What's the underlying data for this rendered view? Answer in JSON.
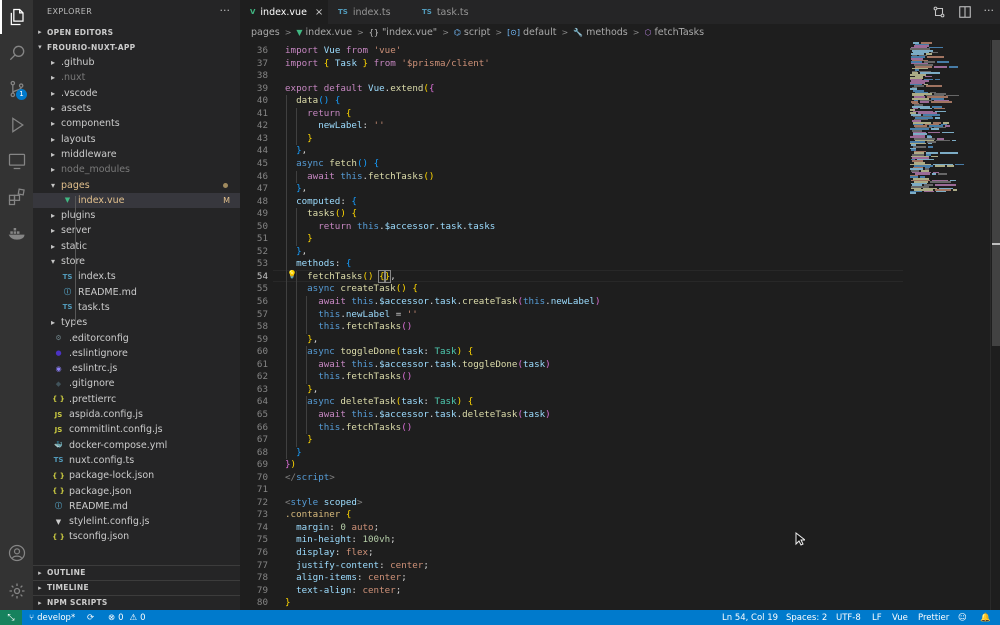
{
  "sidebar": {
    "title": "EXPLORER",
    "open_editors": "OPEN EDITORS",
    "root": "FROURIO-NUXT-APP",
    "outline": "OUTLINE",
    "timeline": "TIMELINE",
    "npm_scripts": "NPM SCRIPTS",
    "tree": [
      {
        "label": ".github",
        "type": "folder"
      },
      {
        "label": ".nuxt",
        "type": "folder",
        "dim": true
      },
      {
        "label": ".vscode",
        "type": "folder"
      },
      {
        "label": "assets",
        "type": "folder"
      },
      {
        "label": "components",
        "type": "folder"
      },
      {
        "label": "layouts",
        "type": "folder"
      },
      {
        "label": "middleware",
        "type": "folder"
      },
      {
        "label": "node_modules",
        "type": "folder",
        "dim": true
      },
      {
        "label": "pages",
        "type": "folder-open",
        "modified": true
      },
      {
        "label": "index.vue",
        "type": "vue",
        "selected": true,
        "modified": true,
        "decoration": "M"
      },
      {
        "label": "plugins",
        "type": "folder"
      },
      {
        "label": "server",
        "type": "folder"
      },
      {
        "label": "static",
        "type": "folder"
      },
      {
        "label": "store",
        "type": "folder-open"
      },
      {
        "label": "index.ts",
        "type": "ts"
      },
      {
        "label": "README.md",
        "type": "md"
      },
      {
        "label": "task.ts",
        "type": "ts"
      },
      {
        "label": "types",
        "type": "folder"
      },
      {
        "label": ".editorconfig",
        "type": "gear"
      },
      {
        "label": ".eslintignore",
        "type": "eslint"
      },
      {
        "label": ".eslintrc.js",
        "type": "eslintjs"
      },
      {
        "label": ".gitignore",
        "type": "git"
      },
      {
        "label": ".prettierrc",
        "type": "json"
      },
      {
        "label": "aspida.config.js",
        "type": "js"
      },
      {
        "label": "commitlint.config.js",
        "type": "js"
      },
      {
        "label": "docker-compose.yml",
        "type": "docker"
      },
      {
        "label": "nuxt.config.ts",
        "type": "ts"
      },
      {
        "label": "package-lock.json",
        "type": "json"
      },
      {
        "label": "package.json",
        "type": "json"
      },
      {
        "label": "README.md",
        "type": "info"
      },
      {
        "label": "stylelint.config.js",
        "type": "stylelint"
      },
      {
        "label": "tsconfig.json",
        "type": "json"
      }
    ]
  },
  "tabs": [
    {
      "label": "index.vue",
      "icon": "V",
      "active": true
    },
    {
      "label": "index.ts",
      "icon": "TS",
      "active": false
    },
    {
      "label": "task.ts",
      "icon": "TS",
      "active": false
    }
  ],
  "breadcrumb": [
    "pages",
    "index.vue",
    "\"index.vue\"",
    "script",
    "default",
    "methods",
    "fetchTasks"
  ],
  "editor": {
    "current_line": 54,
    "lines": [
      {
        "n": 36,
        "html": "<span class='c'>import</span> <span class='v'>Vue</span> <span class='c'>from</span> <span class='s'>'vue'</span>"
      },
      {
        "n": 37,
        "html": "<span class='c'>import</span> <span class='y'>{</span> <span class='v'>Task</span> <span class='y'>}</span> <span class='c'>from</span> <span class='s'>'$prisma/client'</span>"
      },
      {
        "n": 38,
        "html": ""
      },
      {
        "n": 39,
        "html": "<span class='c'>export</span> <span class='c'>default</span> <span class='v'>Vue</span>.<span class='f'>extend</span><span class='y'>(</span><span class='pk'>{</span>"
      },
      {
        "n": 40,
        "html": "  <span class='f'>data</span><span class='bl'>()</span> <span class='bl'>{</span>"
      },
      {
        "n": 41,
        "html": "    <span class='c'>return</span> <span class='y'>{</span>"
      },
      {
        "n": 42,
        "html": "      <span class='v'>newLabel</span>: <span class='s'>''</span>"
      },
      {
        "n": 43,
        "html": "    <span class='y'>}</span>"
      },
      {
        "n": 44,
        "html": "  <span class='bl'>}</span>,"
      },
      {
        "n": 45,
        "html": "  <span class='k'>async</span> <span class='f'>fetch</span><span class='bl'>()</span> <span class='bl'>{</span>"
      },
      {
        "n": 46,
        "html": "    <span class='c'>await</span> <span class='k'>this</span>.<span class='f'>fetchTasks</span><span class='y'>()</span>"
      },
      {
        "n": 47,
        "html": "  <span class='bl'>}</span>,"
      },
      {
        "n": 48,
        "html": "  <span class='v'>computed</span>: <span class='bl'>{</span>"
      },
      {
        "n": 49,
        "html": "    <span class='f'>tasks</span><span class='y'>()</span> <span class='y'>{</span>"
      },
      {
        "n": 50,
        "html": "      <span class='c'>return</span> <span class='k'>this</span>.<span class='v'>$accessor</span>.<span class='v'>task</span>.<span class='v'>tasks</span>"
      },
      {
        "n": 51,
        "html": "    <span class='y'>}</span>"
      },
      {
        "n": 52,
        "html": "  <span class='bl'>}</span>,"
      },
      {
        "n": 53,
        "html": "  <span class='v'>methods</span>: <span class='bl'>{</span>"
      },
      {
        "n": 54,
        "html": "    <span class='f'>fetchTasks</span><span class='y'>()</span> <span class='y' style='outline:1px solid #888'>{</span><span class='y' style='outline:1px solid #888'>}</span>,"
      },
      {
        "n": 55,
        "html": "    <span class='k'>async</span> <span class='f'>createTask</span><span class='y'>()</span> <span class='y'>{</span>"
      },
      {
        "n": 56,
        "html": "      <span class='c'>await</span> <span class='k'>this</span>.<span class='v'>$accessor</span>.<span class='v'>task</span>.<span class='f'>createTask</span><span class='pk'>(</span><span class='k'>this</span>.<span class='v'>newLabel</span><span class='pk'>)</span>"
      },
      {
        "n": 57,
        "html": "      <span class='k'>this</span>.<span class='v'>newLabel</span> = <span class='s'>''</span>"
      },
      {
        "n": 58,
        "html": "      <span class='k'>this</span>.<span class='f'>fetchTasks</span><span class='pk'>()</span>"
      },
      {
        "n": 59,
        "html": "    <span class='y'>}</span>,"
      },
      {
        "n": 60,
        "html": "    <span class='k'>async</span> <span class='f'>toggleDone</span><span class='y'>(</span><span class='v'>task</span>: <span class='t'>Task</span><span class='y'>)</span> <span class='y'>{</span>"
      },
      {
        "n": 61,
        "html": "      <span class='c'>await</span> <span class='k'>this</span>.<span class='v'>$accessor</span>.<span class='v'>task</span>.<span class='f'>toggleDone</span><span class='pk'>(</span><span class='v'>task</span><span class='pk'>)</span>"
      },
      {
        "n": 62,
        "html": "      <span class='k'>this</span>.<span class='f'>fetchTasks</span><span class='pk'>()</span>"
      },
      {
        "n": 63,
        "html": "    <span class='y'>}</span>,"
      },
      {
        "n": 64,
        "html": "    <span class='k'>async</span> <span class='f'>deleteTask</span><span class='y'>(</span><span class='v'>task</span>: <span class='t'>Task</span><span class='y'>)</span> <span class='y'>{</span>"
      },
      {
        "n": 65,
        "html": "      <span class='c'>await</span> <span class='k'>this</span>.<span class='v'>$accessor</span>.<span class='v'>task</span>.<span class='f'>deleteTask</span><span class='pk'>(</span><span class='v'>task</span><span class='pk'>)</span>"
      },
      {
        "n": 66,
        "html": "      <span class='k'>this</span>.<span class='f'>fetchTasks</span><span class='pk'>()</span>"
      },
      {
        "n": 67,
        "html": "    <span class='y'>}</span>"
      },
      {
        "n": 68,
        "html": "  <span class='bl'>}</span>"
      },
      {
        "n": 69,
        "html": "<span class='pk'>}</span><span class='y'>)</span>"
      },
      {
        "n": 70,
        "html": "<span class='g'>&lt;/</span><span class='k'>script</span><span class='g'>&gt;</span>"
      },
      {
        "n": 71,
        "html": ""
      },
      {
        "n": 72,
        "html": "<span class='g'>&lt;</span><span class='k'>style</span> <span class='v'>scoped</span><span class='g'>&gt;</span>"
      },
      {
        "n": 73,
        "html": "<span class='p'>.container</span> <span class='y'>{</span>"
      },
      {
        "n": 74,
        "html": "  <span class='v'>margin</span>: <span class='n'>0</span> <span class='s'>auto</span>;"
      },
      {
        "n": 75,
        "html": "  <span class='v'>min-height</span>: <span class='n'>100vh</span>;"
      },
      {
        "n": 76,
        "html": "  <span class='v'>display</span>: <span class='s'>flex</span>;"
      },
      {
        "n": 77,
        "html": "  <span class='v'>justify-content</span>: <span class='s'>center</span>;"
      },
      {
        "n": 78,
        "html": "  <span class='v'>align-items</span>: <span class='s'>center</span>;"
      },
      {
        "n": 79,
        "html": "  <span class='v'>text-align</span>: <span class='s'>center</span>;"
      },
      {
        "n": 80,
        "html": "<span class='y'>}</span>"
      }
    ]
  },
  "status": {
    "branch": "develop*",
    "errors": "0",
    "warnings": "0",
    "position": "Ln 54, Col 19",
    "spaces": "Spaces: 2",
    "encoding": "UTF-8",
    "eol": "LF",
    "language": "Vue",
    "formatter": "Prettier"
  },
  "colors": {
    "accent": "#007acc",
    "remote": "#16825d",
    "modified": "#e2c08d"
  }
}
